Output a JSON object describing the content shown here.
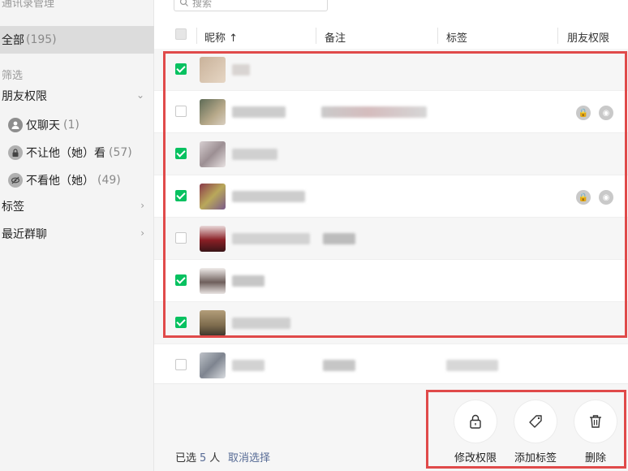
{
  "sidebar": {
    "title": "通讯录管理",
    "all": {
      "label": "全部",
      "count": "(195)"
    },
    "filter_label": "筛选",
    "groups": [
      {
        "label": "朋友权限"
      },
      {
        "label": "标签"
      },
      {
        "label": "最近群聊"
      }
    ],
    "permission_items": [
      {
        "label": "仅聊天",
        "count": "(1)",
        "icon": "person-icon"
      },
      {
        "label": "不让他（她）看",
        "count": "(57)",
        "icon": "lock-icon"
      },
      {
        "label": "不看他（她）",
        "count": "(49)",
        "icon": "hidden-eye-icon"
      }
    ]
  },
  "search": {
    "placeholder": "搜索"
  },
  "table": {
    "columns": {
      "nickname": "昵称 ↑",
      "remark": "备注",
      "tags": "标签",
      "permission": "朋友权限"
    },
    "rows": [
      {
        "checked": true
      },
      {
        "checked": false
      },
      {
        "checked": true
      },
      {
        "checked": true
      },
      {
        "checked": false
      },
      {
        "checked": true
      },
      {
        "checked": true
      },
      {
        "checked": false
      }
    ]
  },
  "footer": {
    "selected_prefix": "已选",
    "selected_count": "5",
    "selected_suffix": "人",
    "cancel_label": "取消选择",
    "actions": [
      {
        "label": "修改权限",
        "icon": "lock-icon"
      },
      {
        "label": "添加标签",
        "icon": "tag-icon"
      },
      {
        "label": "删除",
        "icon": "trash-icon"
      }
    ]
  },
  "colors": {
    "accent_green": "#07c160",
    "link_blue": "#576b95",
    "highlight_red": "#e04a4a"
  }
}
